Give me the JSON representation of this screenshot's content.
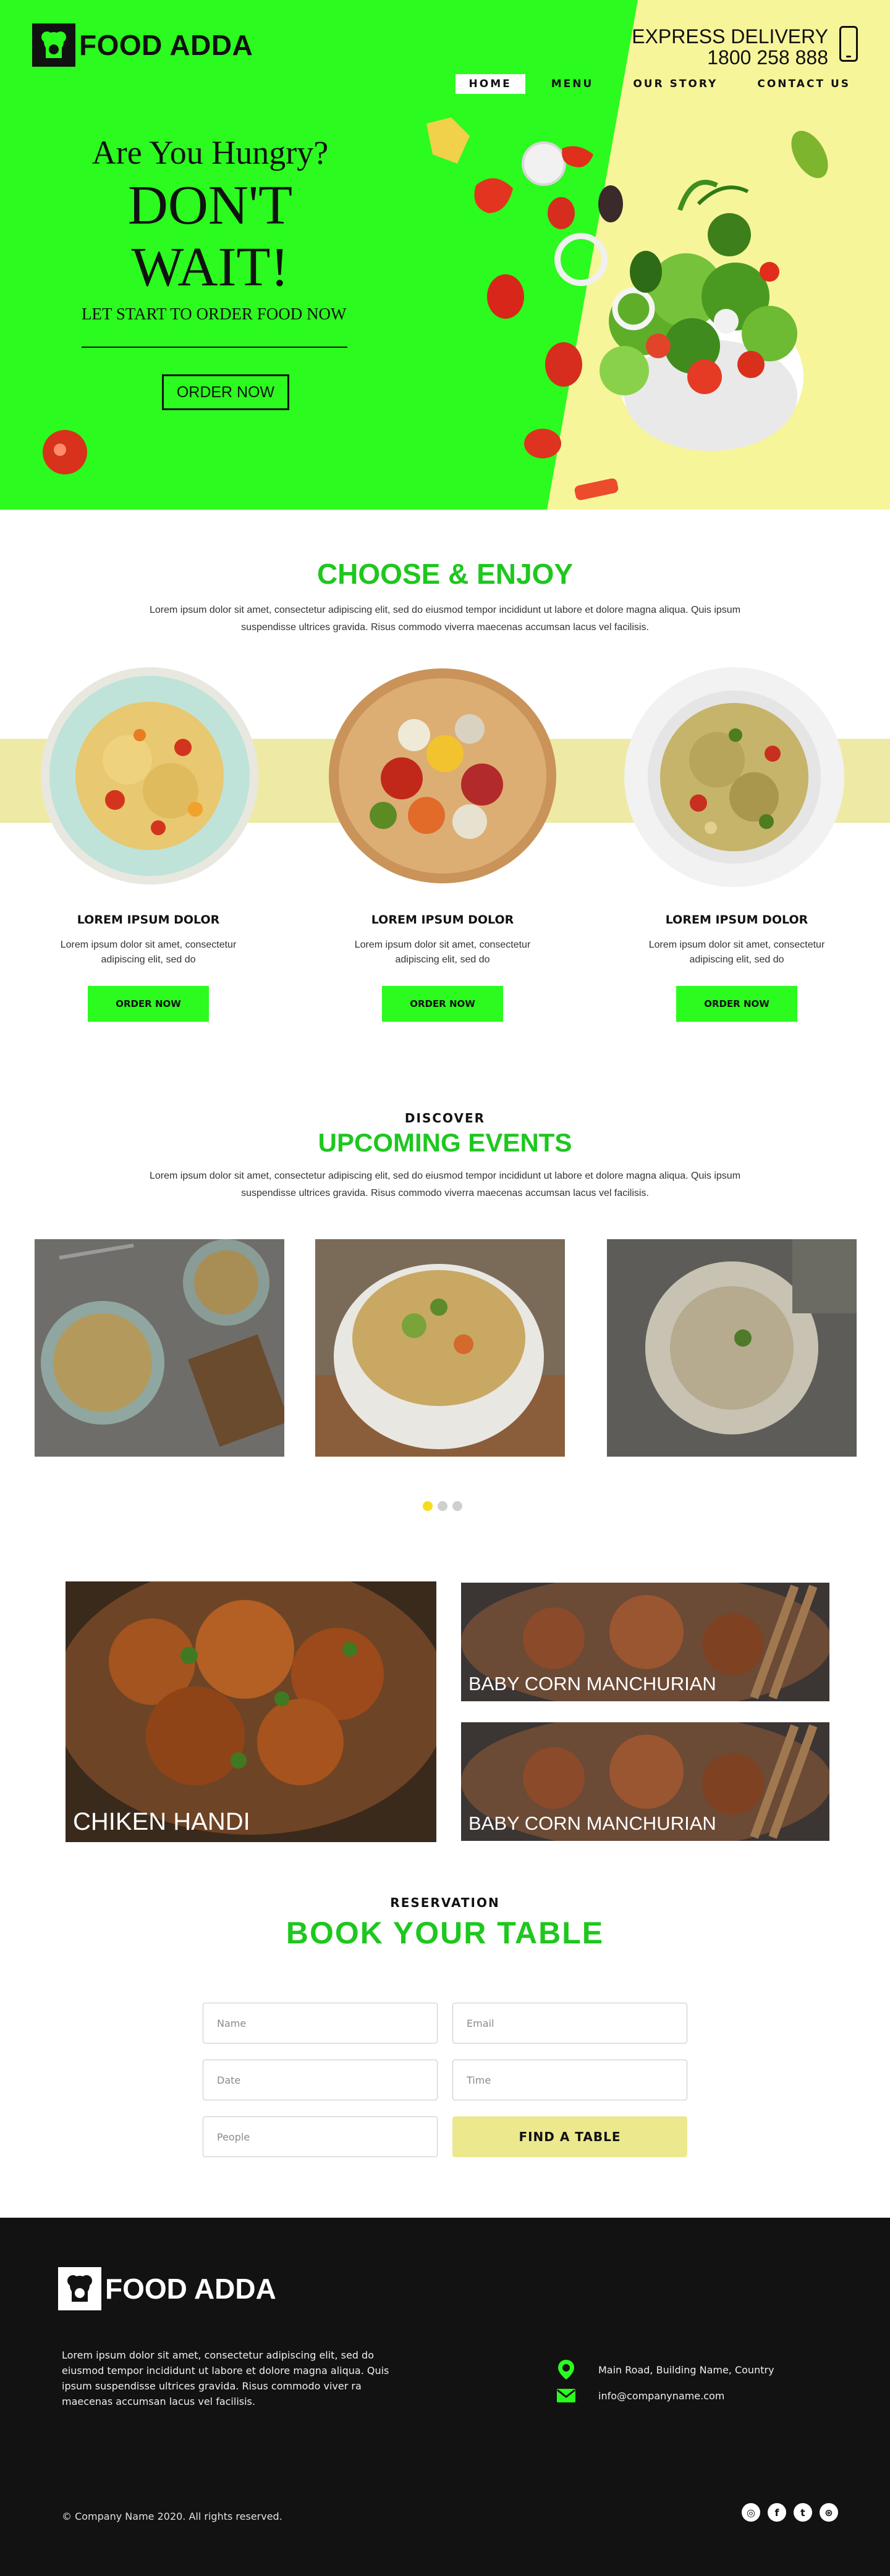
{
  "brand": {
    "name": "FOOD ADDA"
  },
  "header": {
    "express_label": "EXPRESS DELIVERY",
    "express_phone": "1800 258 888",
    "nav": [
      {
        "label": "HOME",
        "active": true
      },
      {
        "label": "MENU",
        "active": false
      },
      {
        "label": "OUR STORY",
        "active": false
      },
      {
        "label": "CONTACT US",
        "active": false
      }
    ]
  },
  "hero": {
    "subtitle": "Are You Hungry?",
    "headline": "DON'T WAIT!",
    "tagline": "LET START TO ORDER FOOD NOW",
    "cta": "ORDER NOW"
  },
  "choose": {
    "title": "CHOOSE & ENJOY",
    "description": "Lorem ipsum dolor sit amet, consectetur adipiscing elit, sed do eiusmod tempor incididunt ut labore et dolore magna aliqua. Quis ipsum suspendisse ultrices gravida. Risus commodo viverra maecenas accumsan lacus vel facilisis.",
    "cards": [
      {
        "title": "LOREM IPSUM DOLOR",
        "text": "Lorem ipsum dolor sit amet, consectetur adipiscing elit, sed do",
        "button": "ORDER NOW"
      },
      {
        "title": "LOREM IPSUM DOLOR",
        "text": "Lorem ipsum dolor sit amet, consectetur adipiscing elit, sed do",
        "button": "ORDER NOW"
      },
      {
        "title": "LOREM IPSUM DOLOR",
        "text": "Lorem ipsum dolor sit amet, consectetur adipiscing elit, sed do",
        "button": "ORDER NOW"
      }
    ]
  },
  "events": {
    "eyebrow": "DISCOVER",
    "title": "UPCOMING EVENTS",
    "description": "Lorem ipsum dolor sit amet, consectetur adipiscing elit, sed do eiusmod tempor incididunt ut labore et dolore magna aliqua. Quis ipsum suspendisse ultrices gravida. Risus commodo viverra maecenas accumsan lacus vel facilisis.",
    "slide_count": 3,
    "active_slide": 1
  },
  "gallery": {
    "main_label": "CHIKEN HANDI",
    "side_labels": [
      "BABY CORN MANCHURIAN",
      "BABY CORN MANCHURIAN"
    ]
  },
  "reservation": {
    "eyebrow": "RESERVATION",
    "title": "BOOK YOUR TABLE",
    "placeholders": {
      "name": "Name",
      "email": "Email",
      "date": "Date",
      "time": "Time",
      "people": "People"
    },
    "submit": "FIND A TABLE"
  },
  "footer": {
    "description": "Lorem ipsum dolor sit amet, consectetur adipiscing elit, sed do eiusmod tempor incididunt ut labore et dolore magna aliqua. Quis ipsum suspendisse ultrices gravida. Risus commodo viver ra maecenas accumsan lacus vel facilisis.",
    "address": "Main Road, Building Name, Country",
    "email": "info@companyname.com",
    "copyright": "© Company Name 2020. All rights reserved.",
    "social_icons": [
      "instagram-icon",
      "facebook-icon",
      "twitter-icon",
      "dribbble-icon"
    ]
  },
  "colors": {
    "hero_green": "#2bfb1f",
    "hero_yellow": "#f7f59a",
    "title_green": "#1ec71e",
    "band_yellow": "#eeeaa6",
    "button_yellow": "#ece88e",
    "footer_bg": "#121212",
    "active_dot": "#f5dd1e"
  }
}
